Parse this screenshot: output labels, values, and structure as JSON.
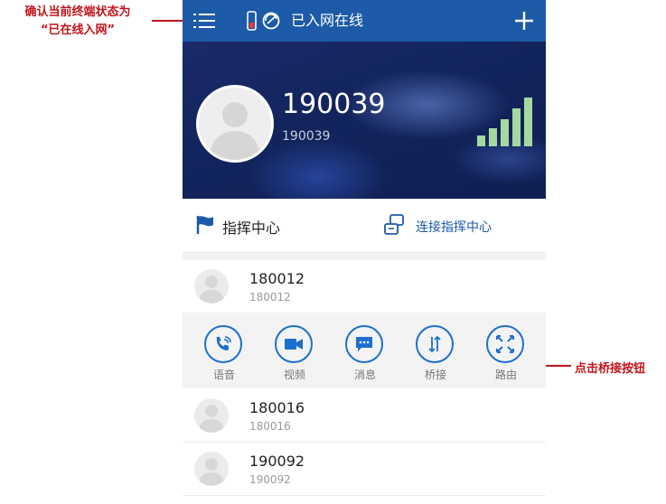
{
  "annotations": {
    "top_left_line1": "确认当前终端状态为",
    "top_left_line2": "“已在线入网”",
    "right": "点击桥接按钮"
  },
  "topbar": {
    "menu_icon": "menu-icon",
    "status_text": "已入网在线",
    "status_icons": [
      "phone-icon",
      "network-link-icon"
    ],
    "add_icon": "plus-icon"
  },
  "profile": {
    "name": "190039",
    "number": "190039",
    "signal_icon": "signal-bars-icon"
  },
  "command_center": {
    "label": "指挥中心",
    "connect_label": "连接指挥中心"
  },
  "contacts": [
    {
      "name": "180012",
      "number": "180012"
    },
    {
      "name": "180016",
      "number": "180016"
    },
    {
      "name": "190092",
      "number": "190092"
    }
  ],
  "actions": [
    {
      "label": "语音",
      "icon": "voice-call-icon"
    },
    {
      "label": "视频",
      "icon": "video-icon"
    },
    {
      "label": "消息",
      "icon": "message-icon"
    },
    {
      "label": "桥接",
      "icon": "bridge-icon"
    },
    {
      "label": "路由",
      "icon": "route-icon"
    }
  ],
  "colors": {
    "brand": "#1d5aa8",
    "accent": "#1d6fcf",
    "annotation": "#c0151b",
    "signal": "#a6d9a0"
  }
}
